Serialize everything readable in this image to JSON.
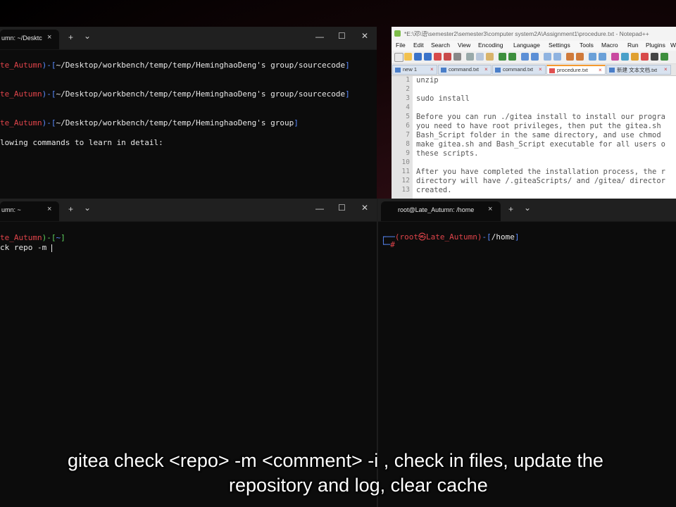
{
  "terminal_top_left": {
    "tab_title": "umn: ~/Desktc",
    "tab_close": "×",
    "new_tab": "+",
    "dropdown": "⌄",
    "controls": {
      "minimize": "—",
      "maximize": "☐",
      "close": "✕"
    },
    "lines": [
      {
        "user": "te_Autumn",
        "sep": ")-[",
        "path": "~/Desktop/workbench/temp/temp/HeminghaoDeng's group/sourcecode",
        "end": "]"
      },
      {
        "user": "te_Autumn",
        "sep": ")-[",
        "path": "~/Desktop/workbench/temp/temp/HeminghaoDeng's group/sourcecode",
        "end": "]"
      },
      {
        "user": "te_Autumn",
        "sep": ")-[",
        "path": "~/Desktop/workbench/temp/temp/HeminghaoDeng's group",
        "end": "]"
      }
    ],
    "info_text": "lowing commands to learn in detail:"
  },
  "terminal_bottom_left": {
    "tab_title": "umn: ~",
    "tab_close": "×",
    "new_tab": "+",
    "dropdown": "⌄",
    "controls": {
      "minimize": "—",
      "maximize": "☐",
      "close": "✕"
    },
    "prompt_user": "te_Autumn",
    "prompt_sep": ")-[",
    "prompt_path": "~",
    "prompt_end": "]",
    "command": "ck repo -m "
  },
  "terminal_bottom_right": {
    "tab_title": "root@Late_Autumn: /home",
    "tab_close": "×",
    "new_tab": "+",
    "dropdown": "⌄",
    "prompt_corner": "┌──",
    "prompt_user": "(root㉿Late_Autumn)",
    "prompt_sep": "-[",
    "prompt_path": "/home",
    "prompt_end": "]",
    "prompt_bottom": "└─",
    "prompt_hash": "#"
  },
  "notepad": {
    "title": "*E:\\邓\\语\\semester2\\semester3\\computer system2A\\Assignment1\\procedure.txt - Notepad++",
    "menu": [
      "File",
      "Edit",
      "Search",
      "View",
      "Encoding",
      "Language",
      "Settings",
      "Tools",
      "Macro",
      "Run",
      "Plugins",
      "W"
    ],
    "tabs": [
      {
        "label": "new 1",
        "active": false
      },
      {
        "label": "command.txt",
        "active": false
      },
      {
        "label": "command.txt",
        "active": false
      },
      {
        "label": "procedure.txt",
        "active": true
      },
      {
        "label": "新建 文本文档.txt",
        "active": false
      }
    ],
    "tab_close_glyph": "×",
    "lines": [
      {
        "num": "1",
        "text": "unzip"
      },
      {
        "num": "2",
        "text": ""
      },
      {
        "num": "3",
        "text": "sudo install"
      },
      {
        "num": "4",
        "text": ""
      },
      {
        "num": "5",
        "text": "Before you can run ./gitea install to install our progra"
      },
      {
        "num": "6",
        "text": "you need to have root privileges, then put the gitea.sh"
      },
      {
        "num": "7",
        "text": "Bash_Script folder in the same directory, and use chmod"
      },
      {
        "num": "8",
        "text": "make gitea.sh and Bash_Script executable for all users o"
      },
      {
        "num": "9",
        "text": "these scripts."
      },
      {
        "num": "10",
        "text": ""
      },
      {
        "num": "11",
        "text": "After you have completed the installation process, the r"
      },
      {
        "num": "12",
        "text": "directory will have /.giteaScripts/ and /gitea/ director"
      },
      {
        "num": "13",
        "text": "created."
      }
    ]
  },
  "subtitle": {
    "line1": "gitea check <repo> -m <comment> -i , check in files, update the",
    "line2": "repository and log, clear cache"
  },
  "colors": {
    "terminal_bg": "#0c0c0c",
    "prompt_red": "#e0444a",
    "prompt_blue": "#5a8cff",
    "prompt_green": "#5fd35f",
    "notepad_active_tab": "#f59a2e"
  }
}
